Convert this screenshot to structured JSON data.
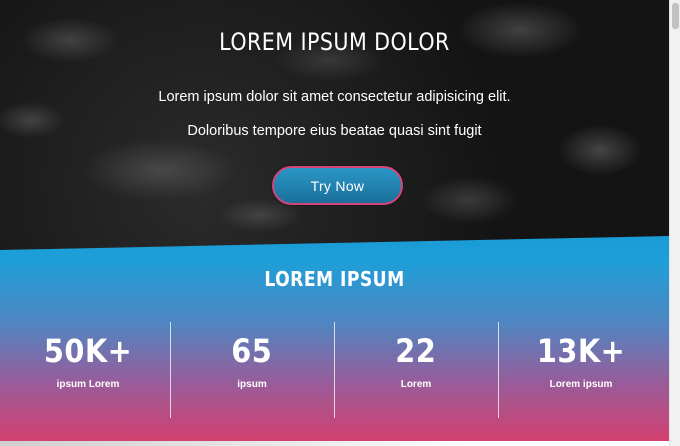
{
  "hero": {
    "title": "LOREM IPSUM DOLOR",
    "line1": "Lorem ipsum dolor sit amet consectetur adipisicing elit.",
    "line2": "Doloribus tempore eius beatae quasi sint fugit",
    "cta_label": "Try Now"
  },
  "stats": {
    "title": "LOREM IPSUM",
    "items": [
      {
        "value": "50K+",
        "label": "ipsum Lorem"
      },
      {
        "value": "65",
        "label": "ipsum"
      },
      {
        "value": "22",
        "label": "Lorem"
      },
      {
        "value": "13K+",
        "label": "Lorem ipsum"
      }
    ]
  },
  "colors": {
    "accent_blue": "#199bd6",
    "accent_pink": "#d5406f",
    "cta_border": "#d6457a"
  }
}
